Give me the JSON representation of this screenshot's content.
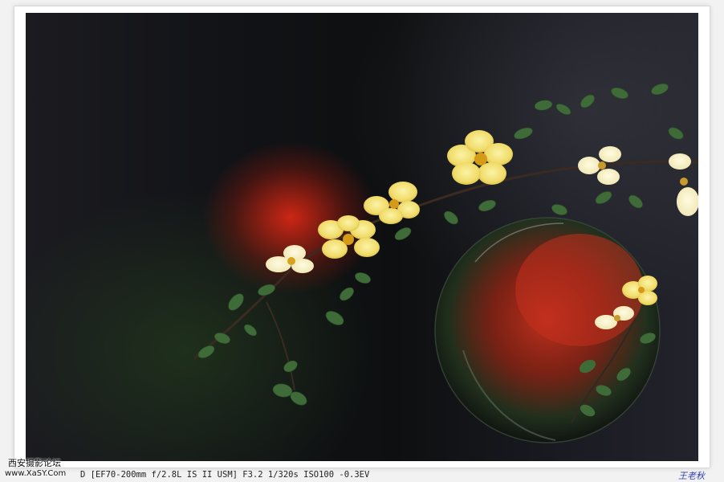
{
  "caption": {
    "exif": "D [EF70-200mm f/2.8L IS II USM] F3.2 1/320s ISO100 -0.3EV"
  },
  "watermark": {
    "line1": "西安摄影论坛",
    "line2": "www.XaSY.Com"
  },
  "signature": "王老秋",
  "photo": {
    "subject": "yellow wild rose branch with glass sphere refraction",
    "colors": {
      "bokeh_red": "#d8281a",
      "petal_yellow": "#f3e07a",
      "leaf_green": "#3f6b3a",
      "background": "#121317"
    }
  }
}
